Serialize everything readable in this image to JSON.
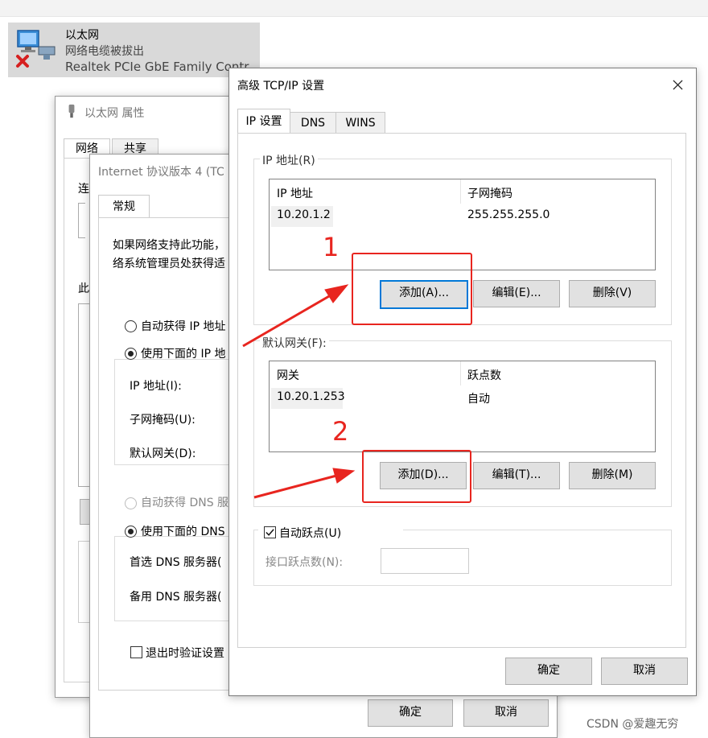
{
  "ethernet_card": {
    "name": "以太网",
    "status": "网络电缆被拔出",
    "adapter": "Realtek PCIe GbE Family Contr"
  },
  "props_window": {
    "title": "以太网 属性",
    "tabs": [
      "网络",
      "共享"
    ],
    "connect_label": "连",
    "items_label": "此"
  },
  "ipv4_window": {
    "title": "Internet 协议版本 4 (TC",
    "tab": "常规",
    "desc_line1": "如果网络支持此功能，",
    "desc_line2": "络系统管理员处获得适",
    "radio_auto_ip": "自动获得 IP 地址",
    "radio_manual_ip": "使用下面的 IP 地",
    "ip_label": "IP 地址(I):",
    "mask_label": "子网掩码(U):",
    "gateway_label": "默认网关(D):",
    "radio_auto_dns": "自动获得 DNS 服",
    "radio_manual_dns": "使用下面的 DNS",
    "dns_pref_label": "首选 DNS 服务器(",
    "dns_alt_label": "备用 DNS 服务器(",
    "validate_label": "退出时验证设置",
    "ok": "确定",
    "cancel": "取消"
  },
  "advanced_window": {
    "title": "高级 TCP/IP 设置",
    "tabs": [
      "IP 设置",
      "DNS",
      "WINS"
    ],
    "ip_group": "IP 地址(R)",
    "ip_headers": [
      "IP 地址",
      "子网掩码"
    ],
    "ip_rows": [
      [
        "10.20.1.2",
        "255.255.255.0"
      ]
    ],
    "ip_add": "添加(A)...",
    "ip_edit": "编辑(E)...",
    "ip_delete": "删除(V)",
    "gw_group": "默认网关(F):",
    "gw_headers": [
      "网关",
      "跃点数"
    ],
    "gw_rows": [
      [
        "10.20.1.253",
        "自动"
      ]
    ],
    "gw_add": "添加(D)...",
    "gw_edit": "编辑(T)...",
    "gw_delete": "删除(M)",
    "auto_metric": "自动跃点(U)",
    "interface_metric": "接口跃点数(N):",
    "ok": "确定",
    "cancel": "取消"
  },
  "annotations": {
    "num1": "1",
    "num2": "2",
    "color": "#e8251f"
  },
  "watermark": "CSDN @爱趣无穷"
}
